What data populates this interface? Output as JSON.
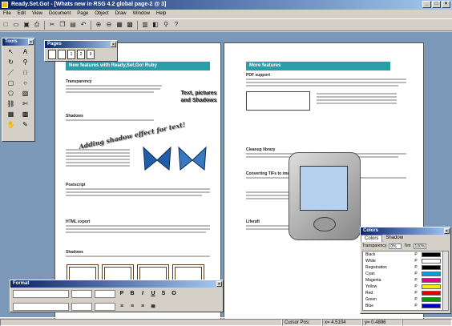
{
  "window": {
    "title": "Ready.Set.Go! - [Whats new in RSG 4.2 global page-2 @ 3]"
  },
  "menu": [
    "File",
    "Edit",
    "View",
    "Document",
    "Page",
    "Object",
    "Draw",
    "Window",
    "Help"
  ],
  "toolbar_icons": [
    "new-icon",
    "open-icon",
    "save-icon",
    "print-icon",
    "cut-icon",
    "copy-icon",
    "paste-icon",
    "undo-icon",
    "zoom-in-icon",
    "zoom-out-icon",
    "grid-icon",
    "snap-icon",
    "table-icon",
    "layer-icon",
    "link-icon",
    "help-icon"
  ],
  "tools_panel": {
    "title": "Tools"
  },
  "pages_panel": {
    "title": "Pages",
    "items": [
      "1",
      "2",
      "3"
    ]
  },
  "document": {
    "left_heading": "New features with Ready,Set,Go! Ruby",
    "shadow_text": "Adding shadow effect for text!",
    "text_shadows": "Text, pictures and Shadows",
    "right_heading": "More features",
    "subheads_left": [
      "Transparency",
      "Shadows",
      "Postscript",
      "HTML export",
      "Shadows"
    ],
    "subheads_right": [
      "PDF support",
      "Cleanup library",
      "Converting TIFs to images",
      "Liferaft"
    ]
  },
  "format_panel": {
    "title": "Format",
    "buttons": [
      "P",
      "B",
      "I",
      "U",
      "S",
      "O"
    ]
  },
  "colors_panel": {
    "title": "Colors",
    "tabs": [
      "Colors",
      "Shadow"
    ],
    "transparency_label": "Transparency",
    "transparency_value": "0%",
    "tint_label": "Tint",
    "tint_value": "100%",
    "rows": [
      {
        "name": "Black",
        "type": "P",
        "color": "#000000"
      },
      {
        "name": "White",
        "type": "P",
        "color": "#ffffff"
      },
      {
        "name": "Registration",
        "type": "P",
        "color": "#000000"
      },
      {
        "name": "Cyan",
        "type": "P",
        "color": "#00a0e0"
      },
      {
        "name": "Magenta",
        "type": "P",
        "color": "#e0008a"
      },
      {
        "name": "Yellow",
        "type": "P",
        "color": "#f8e800"
      },
      {
        "name": "Red",
        "type": "P",
        "color": "#e00000"
      },
      {
        "name": "Green",
        "type": "P",
        "color": "#00a000"
      },
      {
        "name": "Blue",
        "type": "P",
        "color": "#0000c0"
      }
    ]
  },
  "status": {
    "cursor_label": "Cursor Pos:",
    "x": "x= 4.5104",
    "y": "y= 0.4896"
  }
}
